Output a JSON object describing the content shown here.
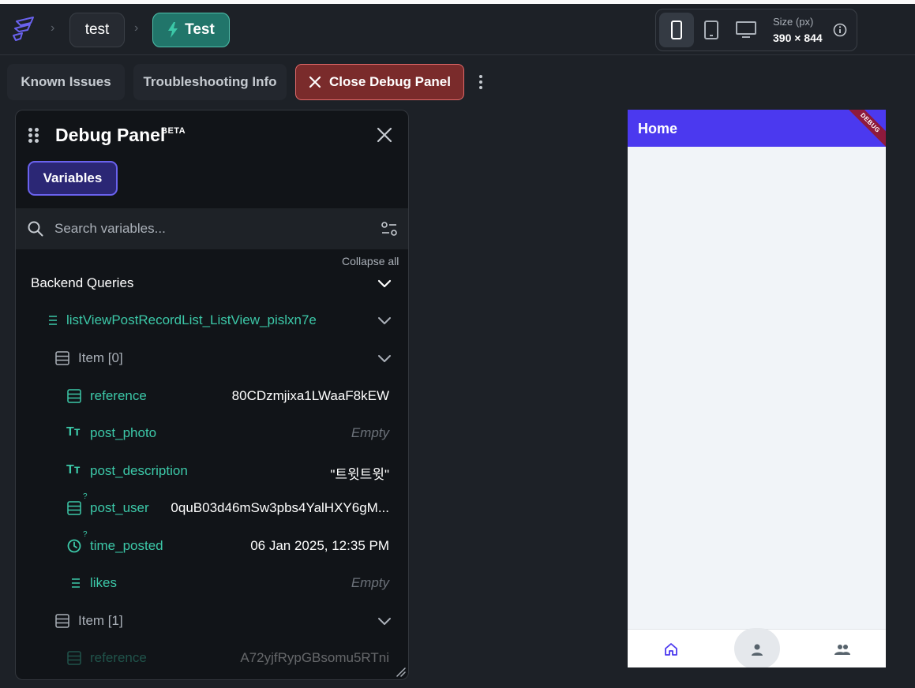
{
  "header": {
    "breadcrumb_project": "test",
    "run_button_label": "Test",
    "size_label": "Size (px)",
    "size_value": "390 × 844"
  },
  "toolbar": {
    "known_issues_label": "Known Issues",
    "troubleshooting_label": "Troubleshooting Info",
    "close_debug_label": "Close Debug Panel"
  },
  "debug_panel": {
    "title": "Debug Panel",
    "badge": "BETA",
    "tab_label": "Variables",
    "search_placeholder": "Search variables...",
    "collapse_all_label": "Collapse all",
    "section_label": "Backend Queries",
    "list_label": "listViewPostRecordList_ListView_pislxn7e",
    "items": [
      {
        "label": "Item [0]",
        "fields": [
          {
            "name": "reference",
            "value": "80CDzmjixa1LWaaF8kEW",
            "icon": "database-icon",
            "optional": false
          },
          {
            "name": "post_photo",
            "value": "Empty",
            "icon": "text-type-icon",
            "optional": false
          },
          {
            "name": "post_description",
            "value": "\"트윗트윗\"",
            "icon": "text-type-icon",
            "optional": false
          },
          {
            "name": "post_user",
            "value": "0quB03d46mSw3pbs4YalHXY6gM...",
            "icon": "database-icon",
            "optional": true
          },
          {
            "name": "time_posted",
            "value": "06 Jan 2025, 12:35 PM",
            "icon": "clock-icon",
            "optional": true
          },
          {
            "name": "likes",
            "value": "Empty",
            "icon": "list-icon",
            "optional": false
          }
        ]
      },
      {
        "label": "Item [1]",
        "fields": [
          {
            "name": "reference",
            "value": "A72yjfRypGBsomu5RTni",
            "icon": "database-icon",
            "optional": false
          }
        ]
      }
    ],
    "optional_marker": "?"
  },
  "preview": {
    "app_title": "Home",
    "ribbon_text": "DEBUG",
    "nav_items": [
      "home-icon",
      "person-icon",
      "group-icon"
    ]
  },
  "colors": {
    "accent": "#4b39ef",
    "teal": "#3cc8a8",
    "danger": "#7a2b2b"
  }
}
